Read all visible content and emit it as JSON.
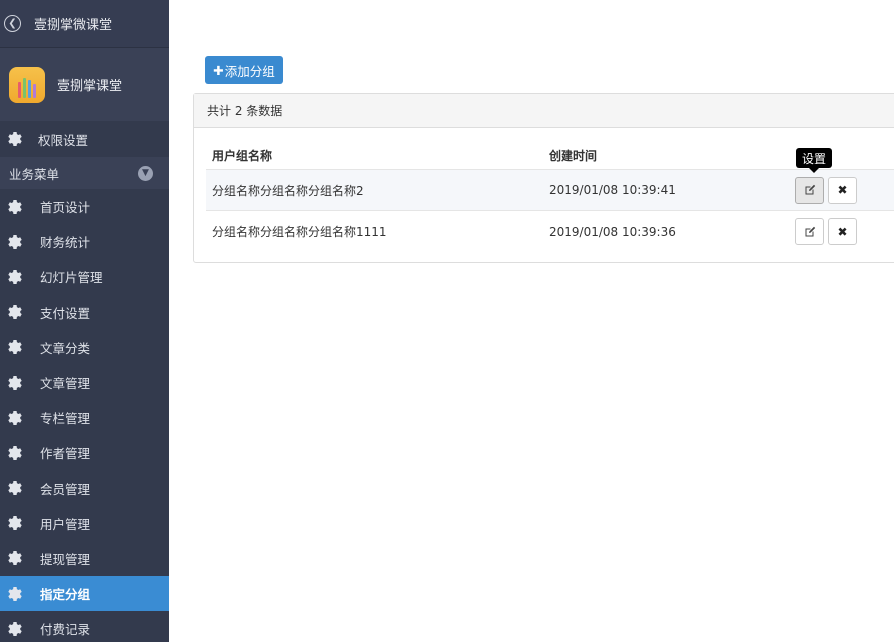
{
  "sidebar": {
    "back_title": "壹捌掌微课堂",
    "brand_name": "壹捌掌课堂",
    "top_item": "权限设置",
    "group_label": "业务菜单",
    "items": [
      {
        "label": "首页设计",
        "active": false
      },
      {
        "label": "财务统计",
        "active": false
      },
      {
        "label": "幻灯片管理",
        "active": false
      },
      {
        "label": "支付设置",
        "active": false
      },
      {
        "label": "文章分类",
        "active": false
      },
      {
        "label": "文章管理",
        "active": false
      },
      {
        "label": "专栏管理",
        "active": false
      },
      {
        "label": "作者管理",
        "active": false
      },
      {
        "label": "会员管理",
        "active": false
      },
      {
        "label": "用户管理",
        "active": false
      },
      {
        "label": "提现管理",
        "active": false
      },
      {
        "label": "指定分组",
        "active": true
      },
      {
        "label": "付费记录",
        "active": false
      }
    ]
  },
  "main": {
    "add_button": "添加分组",
    "summary": "共计 2 条数据",
    "columns": [
      "用户组名称",
      "创建时间"
    ],
    "rows": [
      {
        "name": "分组名称分组名称分组名称2",
        "created": "2019/01/08 10:39:41"
      },
      {
        "name": "分组名称分组名称分组名称1111",
        "created": "2019/01/08 10:39:36"
      }
    ],
    "tooltip": "设置"
  },
  "colors": {
    "sidebar_bg": "#333a4d",
    "active_bg": "#3a8cd3",
    "primary_button": "#3a8ad0"
  },
  "icons": {
    "back": "circle-chevron-left-icon",
    "menu": "gear-icon",
    "group_toggle": "chevron-down-circle-icon",
    "edit": "edit-icon",
    "delete": "close-icon",
    "add": "plus-icon"
  }
}
